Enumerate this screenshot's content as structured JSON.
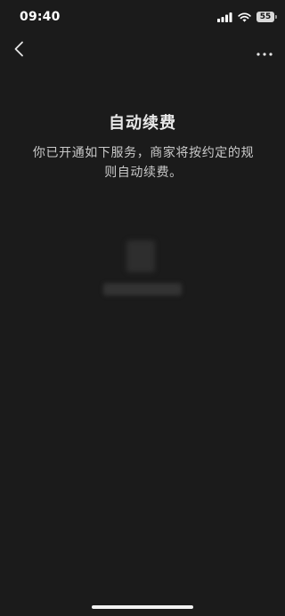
{
  "status_bar": {
    "time": "09:40",
    "battery_level": "55",
    "signal_icon": "cellular-signal-icon",
    "wifi_icon": "wifi-icon",
    "battery_icon": "battery-icon"
  },
  "nav": {
    "back_icon": "chevron-left-icon",
    "more_icon": "more-dots-icon"
  },
  "main": {
    "title": "自动续费",
    "description": "你已开通如下服务，商家将按约定的规则自动续费。"
  },
  "colors": {
    "background": "#1b1b1b",
    "text_primary": "#e8e8e8",
    "text_secondary": "#c9c9c9"
  }
}
